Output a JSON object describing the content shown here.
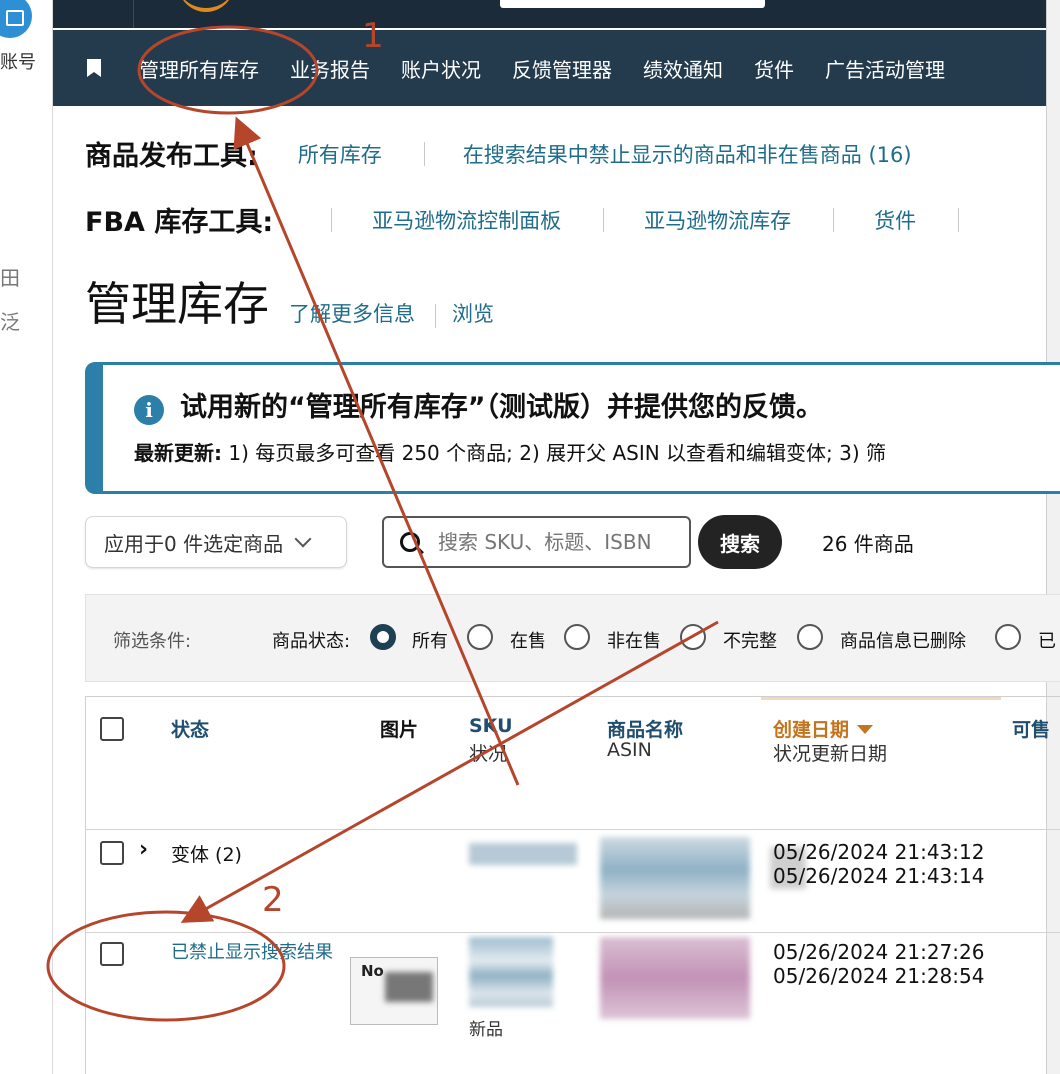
{
  "left_panel": {
    "account_label": "账号",
    "fragment_1": "田",
    "fragment_2": "泛"
  },
  "nav": {
    "items": [
      "管理所有库存",
      "业务报告",
      "账户状况",
      "反馈管理器",
      "绩效通知",
      "货件",
      "广告活动管理"
    ]
  },
  "listing_tools": {
    "label": "商品发布工具:",
    "links": [
      "所有库存",
      "在搜索结果中禁止显示的商品和非在售商品 (16)"
    ]
  },
  "fba_tools": {
    "label": "FBA 库存工具:",
    "links": [
      "亚马逊物流控制面板",
      "亚马逊物流库存",
      "货件"
    ]
  },
  "page": {
    "title": "管理库存",
    "learn_more": "了解更多信息",
    "browse": "浏览"
  },
  "banner": {
    "title": "试用新的“管理所有库存”（测试版）并提供您的反馈。",
    "note_label": "最新更新:",
    "note_text": " 1) 每页最多可查看 250 个商品; 2) 展开父 ASIN 以查看和编辑变体; 3) 筛"
  },
  "toolbar": {
    "apply_label": "应用于0 件选定商品",
    "search_placeholder": "搜索 SKU、标题、ISBN",
    "search_button": "搜索",
    "result_count": "26 件商品"
  },
  "filters": {
    "label": "筛选条件:",
    "status_label": "商品状态:",
    "options": [
      "所有",
      "在售",
      "非在售",
      "不完整",
      "商品信息已删除",
      "已"
    ],
    "selected": "所有"
  },
  "table": {
    "headers": {
      "status": "状态",
      "image": "图片",
      "sku": "SKU",
      "sku_sub": "状况",
      "name": "商品名称",
      "name_sub": "ASIN",
      "created": "创建日期",
      "created_sub": "状况更新日期",
      "available": "可售"
    },
    "rows": [
      {
        "status": "变体 (2)",
        "created": "05/26/2024 21:43:12",
        "updated": "05/26/2024 21:43:14",
        "condition": ""
      },
      {
        "status": "已禁止显示搜索结果",
        "image_text": "No",
        "created": "05/26/2024 21:27:26",
        "updated": "05/26/2024 21:28:54",
        "condition": "新品"
      }
    ]
  },
  "annotations": {
    "step1": "1",
    "step2": "2",
    "color": "#b5462b"
  },
  "colors": {
    "nav_bg": "#243a4d",
    "top_bg": "#1b2b3a",
    "link": "#1f6d8a",
    "banner_accent": "#2b7fa8",
    "sort_accent": "#c4741f"
  }
}
